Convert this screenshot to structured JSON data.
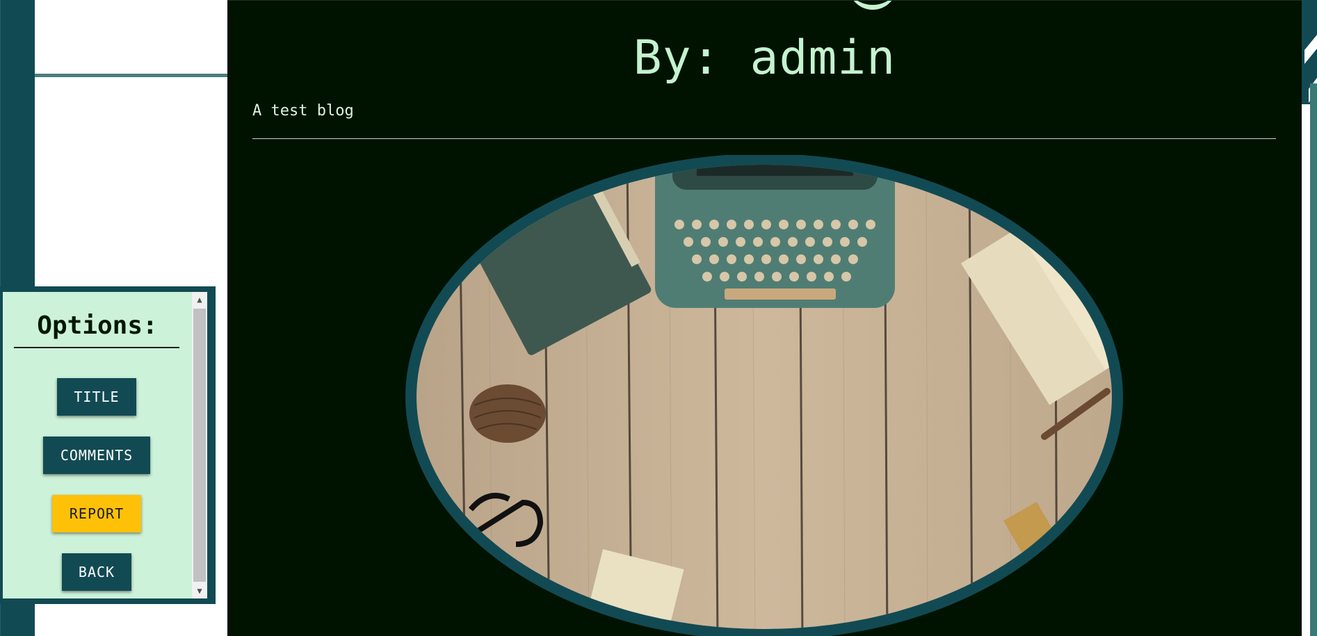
{
  "post": {
    "byline": "By: admin",
    "subtitle": "A test blog",
    "image_alt": "Vintage typewriter on wooden desk"
  },
  "options": {
    "title": "Options:",
    "buttons": {
      "title": "TITLE",
      "comments": "COMMENTS",
      "report": "REPORT",
      "back": "BACK"
    }
  },
  "colors": {
    "panel_bg": "#001200",
    "accent_teal": "#124a53",
    "options_bg": "#ccf2da",
    "report_yellow": "#ffc107",
    "text_mint": "#c4f3cf"
  },
  "icons": {
    "scroll_up": "▲",
    "scroll_down": "▼"
  }
}
